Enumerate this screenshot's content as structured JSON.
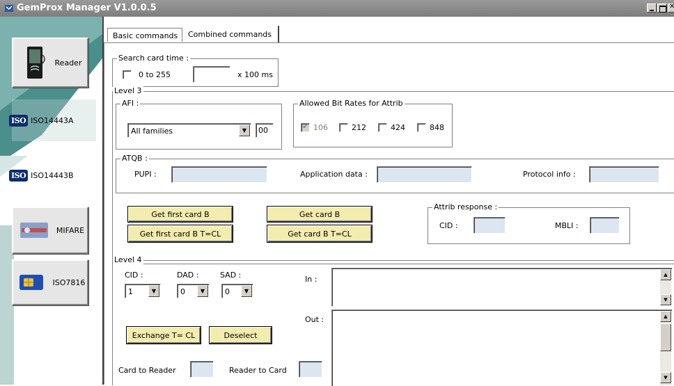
{
  "window": {
    "title": "GemProx Manager V1.0.0.5"
  },
  "sidebar": {
    "items": [
      {
        "label": "Reader",
        "icon": "reader-icon"
      },
      {
        "label": "ISO14443A",
        "icon": "iso-logo-icon",
        "logo_text": "ISO"
      },
      {
        "label": "ISO14443B",
        "icon": "iso-logo-icon",
        "logo_text": "ISO"
      },
      {
        "label": "MIFARE",
        "icon": "mifare-card-icon"
      },
      {
        "label": "ISO7816",
        "icon": "smartcard-chip-icon"
      }
    ]
  },
  "tabs": [
    {
      "label": "Basic commands",
      "active": false
    },
    {
      "label": "Combined commands",
      "active": true
    }
  ],
  "search": {
    "legend": "Search card time :",
    "checkbox_label": "0 to 255",
    "value": "",
    "unit": "x 100 ms"
  },
  "level3": {
    "legend": "Level 3",
    "afi": {
      "legend": "AFI :",
      "selected": "All families",
      "value": "00"
    },
    "bitrates": {
      "legend": "Allowed Bit Rates for Attrib",
      "options": [
        {
          "label": "106",
          "checked": true,
          "disabled": true
        },
        {
          "label": "212",
          "checked": false
        },
        {
          "label": "424",
          "checked": false
        },
        {
          "label": "848",
          "checked": false
        }
      ]
    },
    "atqb": {
      "legend": "ATQB :",
      "pupi_label": "PUPI :",
      "appdata_label": "Application data :",
      "protocol_label": "Protocol info :"
    },
    "buttons": {
      "get_first_card_b": "Get first card B",
      "get_card_b": "Get card B",
      "get_first_card_b_tcl": "Get first card B T=CL",
      "get_card_b_tcl": "Get card B T=CL"
    },
    "attrib": {
      "legend": "Attrib response :",
      "cid_label": "CID :",
      "mbli_label": "MBLI :"
    }
  },
  "level4": {
    "legend": "Level 4",
    "cid": {
      "label": "CID :",
      "value": "1"
    },
    "dad": {
      "label": "DAD :",
      "value": "0"
    },
    "sad": {
      "label": "SAD :",
      "value": "0"
    },
    "in_label": "In :",
    "out_label": "Out :",
    "exchange_button": "Exchange T= CL",
    "deselect_button": "Deselect",
    "card_to_reader_label": "Card to Reader",
    "reader_to_card_label": "Reader to Card"
  },
  "colors": {
    "button_yellow": "#f3ecaf",
    "field_blue": "#dce6f0",
    "sidebar_teal": "#4a8f8c",
    "titlebar": "#8c8c8c"
  }
}
